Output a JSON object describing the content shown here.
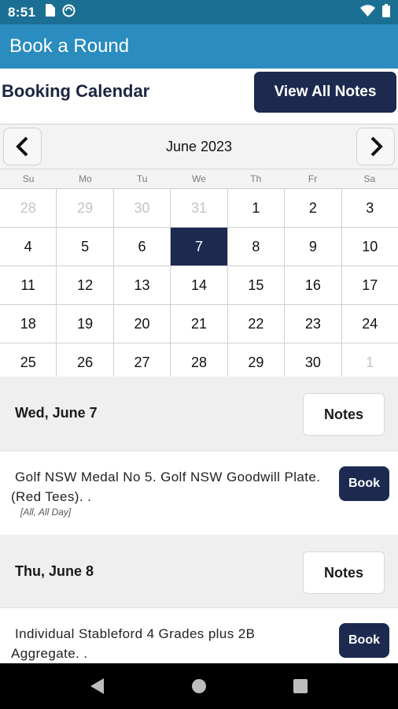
{
  "status_bar": {
    "time": "8:51"
  },
  "app_bar": {
    "title": "Book a Round"
  },
  "header": {
    "title": "Booking Calendar",
    "view_all_notes_label": "View All Notes"
  },
  "calendar": {
    "month_label": "June 2023",
    "weekdays": [
      "Su",
      "Mo",
      "Tu",
      "We",
      "Th",
      "Fr",
      "Sa"
    ],
    "weeks": [
      [
        {
          "d": "28",
          "muted": true
        },
        {
          "d": "29",
          "muted": true
        },
        {
          "d": "30",
          "muted": true
        },
        {
          "d": "31",
          "muted": true
        },
        {
          "d": "1"
        },
        {
          "d": "2"
        },
        {
          "d": "3"
        }
      ],
      [
        {
          "d": "4"
        },
        {
          "d": "5"
        },
        {
          "d": "6"
        },
        {
          "d": "7",
          "selected": true
        },
        {
          "d": "8"
        },
        {
          "d": "9"
        },
        {
          "d": "10"
        }
      ],
      [
        {
          "d": "11"
        },
        {
          "d": "12"
        },
        {
          "d": "13"
        },
        {
          "d": "14"
        },
        {
          "d": "15"
        },
        {
          "d": "16"
        },
        {
          "d": "17"
        }
      ],
      [
        {
          "d": "18"
        },
        {
          "d": "19"
        },
        {
          "d": "20"
        },
        {
          "d": "21"
        },
        {
          "d": "22"
        },
        {
          "d": "23"
        },
        {
          "d": "24"
        }
      ],
      [
        {
          "d": "25"
        },
        {
          "d": "26"
        },
        {
          "d": "27"
        },
        {
          "d": "28"
        },
        {
          "d": "29"
        },
        {
          "d": "30"
        },
        {
          "d": "1",
          "muted": true
        }
      ]
    ]
  },
  "schedule": [
    {
      "date_label": "Wed, June 7",
      "notes_label": "Notes",
      "event_text": "Golf NSW Medal No 5. Golf NSW Goodwill Plate. (Red Tees). .",
      "event_meta": "[All, All Day]",
      "book_label": "Book"
    },
    {
      "date_label": "Thu, June 8",
      "notes_label": "Notes",
      "event_text": "Individual Stableford 4 Grades plus 2B Aggregate. .",
      "event_meta": "",
      "book_label": "Book"
    }
  ],
  "colors": {
    "status_bar": "#1b6f93",
    "app_bar": "#2a8cbf",
    "primary_dark": "#1c2a4f"
  },
  "icons": [
    "sim-card-icon",
    "data-saver-icon",
    "wifi-icon",
    "battery-icon",
    "chevron-left-icon",
    "chevron-right-icon",
    "back-triangle-icon",
    "home-circle-icon",
    "recents-square-icon"
  ]
}
